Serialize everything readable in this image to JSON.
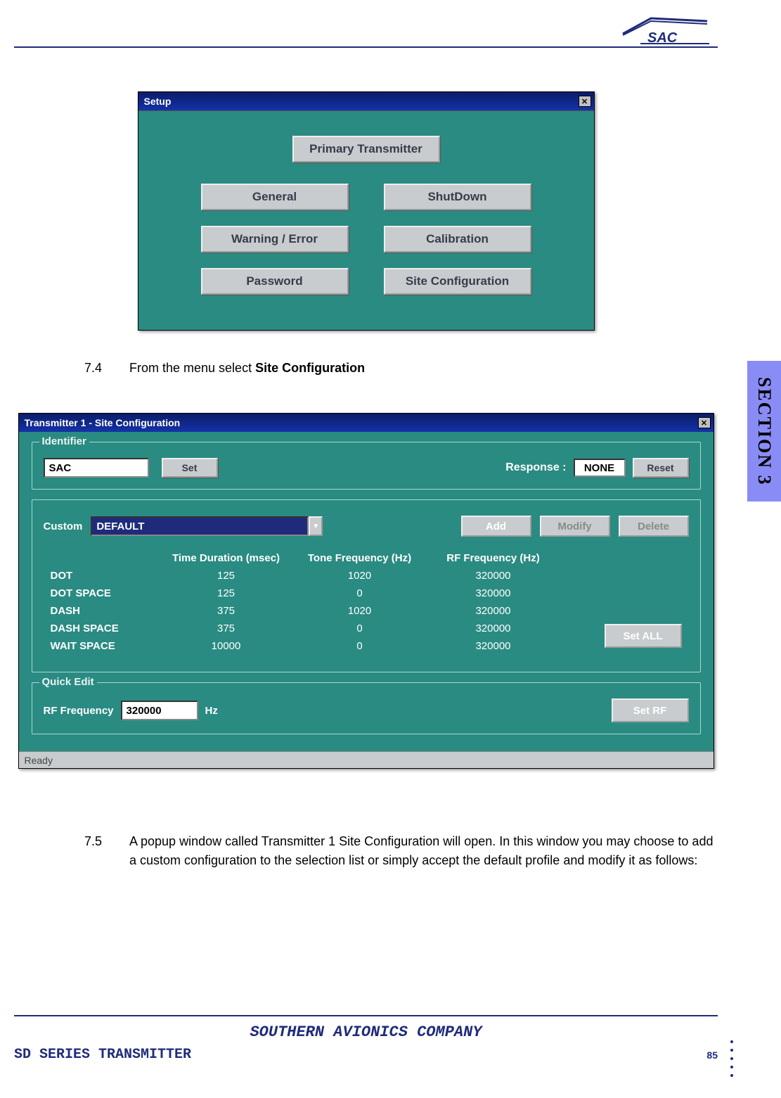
{
  "logo_alt": "SAC",
  "section_tab": "SECTION 3",
  "setup_window": {
    "title": "Setup",
    "buttons": {
      "primary": "Primary Transmitter",
      "general": "General",
      "shutdown": "ShutDown",
      "warning": "Warning / Error",
      "calibration": "Calibration",
      "password": "Password",
      "siteconf": "Site Configuration"
    }
  },
  "step74": {
    "num": "7.4",
    "text_pre": "From the menu select ",
    "text_bold": "Site Configuration"
  },
  "siteconf_window": {
    "title": "Transmitter 1 - Site Configuration",
    "identifier_legend": "Identifier",
    "identifier_value": "SAC",
    "set_label": "Set",
    "response_label": "Response :",
    "response_value": "NONE",
    "reset_label": "Reset",
    "custom_label": "Custom",
    "dropdown_value": "DEFAULT",
    "add_label": "Add",
    "modify_label": "Modify",
    "delete_label": "Delete",
    "headers": {
      "h1": "",
      "h2": "Time Duration (msec)",
      "h3": "Tone Frequency (Hz)",
      "h4": "RF Frequency (Hz)"
    },
    "rows": [
      {
        "label": "DOT",
        "time": "125",
        "tone": "1020",
        "rf": "320000"
      },
      {
        "label": "DOT SPACE",
        "time": "125",
        "tone": "0",
        "rf": "320000"
      },
      {
        "label": "DASH",
        "time": "375",
        "tone": "1020",
        "rf": "320000"
      },
      {
        "label": "DASH SPACE",
        "time": "375",
        "tone": "0",
        "rf": "320000"
      },
      {
        "label": "WAIT SPACE",
        "time": "10000",
        "tone": "0",
        "rf": "320000"
      }
    ],
    "set_all_label": "Set ALL",
    "quick_legend": "Quick Edit",
    "rf_label": "RF Frequency",
    "rf_value": "320000",
    "hz_label": "Hz",
    "set_rf_label": "Set RF",
    "status": "Ready"
  },
  "step75": {
    "num": "7.5",
    "text": "A popup window called Transmitter 1 Site Configuration will open. In this window you may choose to add a custom configuration to the selection list or simply accept the default profile and modify it as follows:"
  },
  "footer": {
    "company": "SOUTHERN AVIONICS COMPANY",
    "product": "SD SERIES TRANSMITTER",
    "page": "85"
  }
}
